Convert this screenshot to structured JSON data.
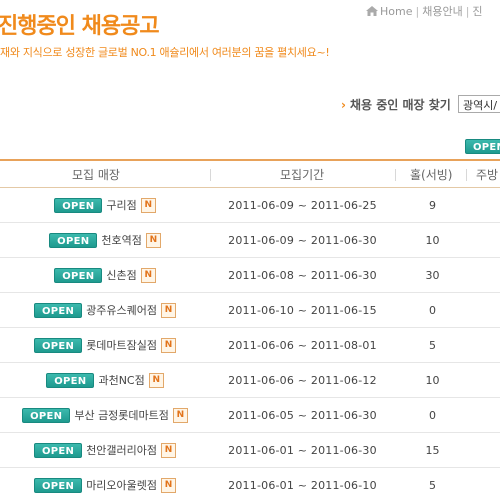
{
  "header": {
    "title": "진행중인 채용공고",
    "subtitle": "재와 지식으로 성장한 글로벌 NO.1 애슐리에서 여러분의 꿈을 펼치세요~!"
  },
  "breadcrumb": {
    "items": [
      "Home",
      "채용안내",
      "진"
    ]
  },
  "finder": {
    "label": "채용 중인 매장 찾기",
    "region_value": "광역시/"
  },
  "open_label": "OPEN",
  "new_label": "N",
  "table": {
    "columns": [
      "모집 매장",
      "모집기간",
      "홀(서빙)",
      "주방"
    ],
    "rows": [
      {
        "store": "구리점",
        "period": "2011-06-09 ~ 2011-06-25",
        "count": "9"
      },
      {
        "store": "천호역점",
        "period": "2011-06-09 ~ 2011-06-30",
        "count": "10"
      },
      {
        "store": "신촌점",
        "period": "2011-06-08 ~ 2011-06-30",
        "count": "30"
      },
      {
        "store": "광주유스퀘어점",
        "period": "2011-06-10 ~ 2011-06-15",
        "count": "0"
      },
      {
        "store": "롯데마트잠실점",
        "period": "2011-06-06 ~ 2011-08-01",
        "count": "5"
      },
      {
        "store": "과천NC점",
        "period": "2011-06-06 ~ 2011-06-12",
        "count": "10"
      },
      {
        "store": "부산 금정롯데마트점",
        "period": "2011-06-05 ~ 2011-06-30",
        "count": "0"
      },
      {
        "store": "천안갤러리아점",
        "period": "2011-06-01 ~ 2011-06-30",
        "count": "15"
      },
      {
        "store": "마리오아울렛점",
        "period": "2011-06-01 ~ 2011-06-10",
        "count": "5"
      }
    ]
  },
  "colors": {
    "accent": "#f08a1c",
    "open_button": "#2aa89c"
  }
}
